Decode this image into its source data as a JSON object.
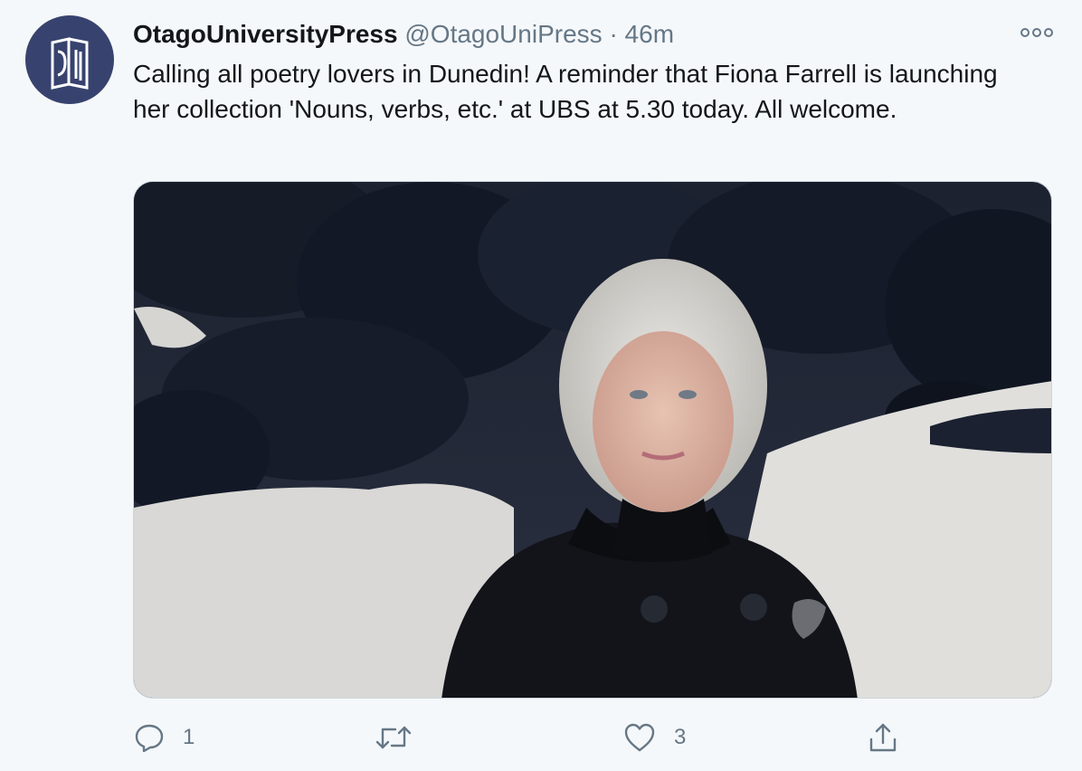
{
  "tweet": {
    "author_name": "OtagoUniversityPress",
    "handle": "@OtagoUniPress",
    "separator": "·",
    "time": "46m",
    "text": "Calling all poetry lovers in Dunedin! A reminder that Fiona Farrell is launching her collection 'Nouns, verbs, etc.' at UBS at 5.30 today. All welcome."
  },
  "avatar": {
    "icon": "otago-press-logo",
    "bg": "#37436e"
  },
  "media": {
    "type": "photo",
    "alt_subject": "portrait"
  },
  "actions": {
    "reply_count": "1",
    "retweet_count": "",
    "like_count": "3",
    "share_count": ""
  },
  "colors": {
    "text": "#14171a",
    "secondary": "#657786",
    "background": "#f5f8fa",
    "border": "#ccd6dd"
  }
}
